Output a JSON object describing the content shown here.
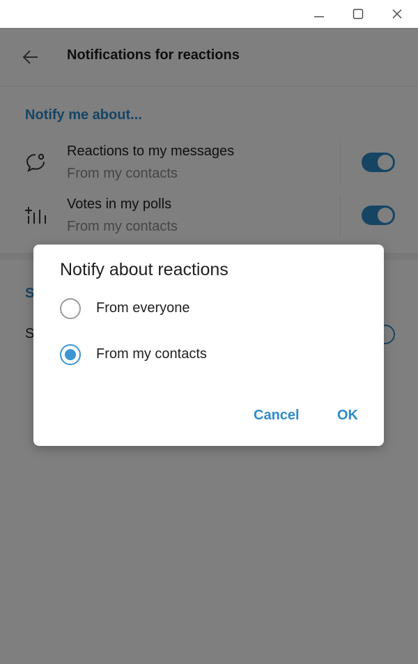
{
  "window": {
    "controls": [
      "minimize-icon",
      "maximize-icon",
      "close-icon"
    ]
  },
  "header": {
    "title": "Notifications for reactions",
    "back_icon": "arrow-left-icon"
  },
  "section1": {
    "title": "Notify me about...",
    "rows": [
      {
        "icon": "reaction-bubble-icon",
        "title": "Reactions to my messages",
        "subtitle": "From my contacts",
        "toggle_on": true
      },
      {
        "icon": "poll-icon",
        "title": "Votes in my polls",
        "subtitle": "From my contacts",
        "toggle_on": true
      }
    ]
  },
  "section2": {
    "title_visible": "S",
    "row_title_visible": "S"
  },
  "dialog": {
    "title": "Notify about reactions",
    "options": [
      {
        "label": "From everyone",
        "selected": false
      },
      {
        "label": "From my contacts",
        "selected": true
      }
    ],
    "cancel_label": "Cancel",
    "ok_label": "OK"
  },
  "colors": {
    "accent": "#2d8bc9",
    "radio_accent": "#3b96d4",
    "overlay": "rgba(0,0,0,0.5)"
  }
}
